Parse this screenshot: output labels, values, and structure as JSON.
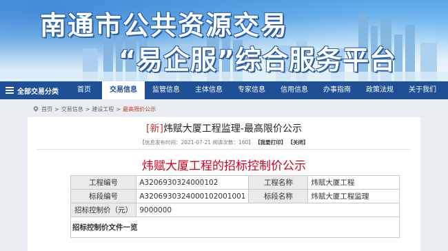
{
  "banner": {
    "title_line1": "南通市公共资源交易",
    "title_line2": "“易企服”综合服务平台"
  },
  "nav": {
    "category_label": "全部交易分类",
    "items": [
      {
        "label": "首页"
      },
      {
        "label": "交易信息"
      },
      {
        "label": "监管信息"
      },
      {
        "label": "主体信息"
      },
      {
        "label": "专家信息"
      },
      {
        "label": "信用信息"
      },
      {
        "label": "办事指南"
      },
      {
        "label": "政策法规"
      },
      {
        "label": "关于我们"
      }
    ],
    "active_index": 1
  },
  "breadcrumb": {
    "items": [
      "首页",
      "交易信息",
      "建设工程"
    ],
    "separator": ">",
    "current": "最高限价公示"
  },
  "article": {
    "tag": "[新]",
    "title": "炜赋大厦工程监理-最高限价公示",
    "meta_date_label": "【信息发布时间：",
    "meta_date": "2021-07-21",
    "meta_views_label": "阅读次数：",
    "meta_views": "160",
    "meta_close": "】",
    "meta_link_correction": "【我要打印】",
    "meta_link_close": "【关闭】"
  },
  "document": {
    "title": "炜赋大厦工程的招标控制价公示",
    "rows": [
      {
        "label1": "工程编号",
        "value1": "A3206930324000102",
        "label2": "工程名称",
        "value2": "炜赋大厦工程"
      },
      {
        "label1": "标段编号",
        "value1": "A3206930324000102001001",
        "label2": "标段名称",
        "value2": "炜赋大厦工程监理"
      }
    ],
    "control_price_label": "招标控制价（元）",
    "control_price_value": "9000000",
    "section_label": "招标控制价文件一览"
  },
  "colors": {
    "nav_bg": "#1f4f94",
    "accent_red": "#d0021b"
  }
}
